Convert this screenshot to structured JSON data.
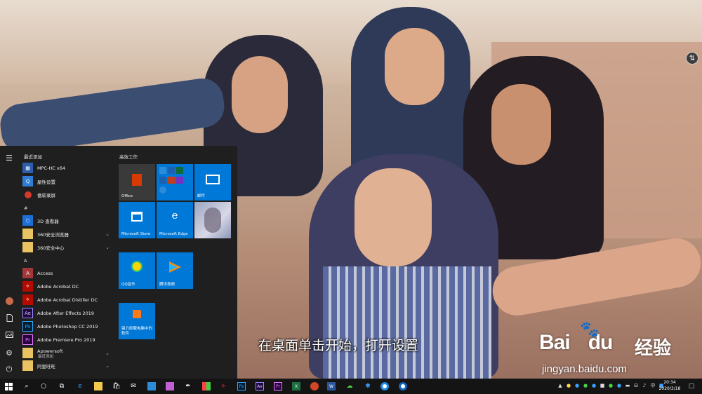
{
  "start_menu": {
    "recent_header": "最近添加",
    "tiles_header": "高效工作",
    "recent_apps": [
      {
        "label": "MPC-HC x64",
        "icon": "mpc-hc-icon",
        "color": "#2b5fae"
      },
      {
        "label": "屋性设置",
        "icon": "settings-tool-icon",
        "color": "#2f7dd6"
      },
      {
        "label": "傲软录屏",
        "icon": "screen-recorder-icon",
        "color": "#d33a2c"
      }
    ],
    "section_hash": "#",
    "hash_apps": [
      {
        "label": "3D 查看器",
        "icon": "3d-viewer-icon",
        "color": "#1d6fd8"
      },
      {
        "label": "360安全浏览器",
        "icon": "folder-icon",
        "color": "#e9c261"
      },
      {
        "label": "360安全中心",
        "icon": "folder-icon",
        "color": "#e9c261"
      }
    ],
    "section_a": "A",
    "a_apps": [
      {
        "label": "Access",
        "icon": "access-icon",
        "color": "#a4373a"
      },
      {
        "label": "Adobe Acrobat DC",
        "icon": "acrobat-icon",
        "color": "#b30b00"
      },
      {
        "label": "Adobe Acrobat Distiller DC",
        "icon": "acrobat-distiller-icon",
        "color": "#b30b00"
      },
      {
        "label": "Adobe After Effects 2019",
        "icon": "after-effects-icon",
        "color": "#1f0740"
      },
      {
        "label": "Adobe Photoshop CC 2019",
        "icon": "photoshop-icon",
        "color": "#001d34"
      },
      {
        "label": "Adobe Premiere Pro 2019",
        "icon": "premiere-icon",
        "color": "#2a003f"
      },
      {
        "label": "Apowersoft",
        "icon": "folder-icon",
        "color": "#e9c261"
      },
      {
        "label": "阿里旺旺",
        "icon": "folder-icon",
        "color": "#e9c261"
      }
    ],
    "apowersoft_sub": "最近添加",
    "ae_abbr": "Ae",
    "ps_abbr": "Ps",
    "pr_abbr": "Pr",
    "tiles": {
      "office": "Office",
      "mail": "邮件",
      "store": "Microsoft Store",
      "edge": "Microsoft Edge",
      "qq_music": "QQ音乐",
      "tencent_video": "腾讯视频",
      "uninstaller": "强力卸载电脑中的软件"
    },
    "accent_color": "#0078d7"
  },
  "caption": "在桌面单击开始，打开设置",
  "watermark": {
    "brand": "Bai",
    "brand2": "du",
    "cn": "经验",
    "url": "jingyan.baidu.com"
  },
  "taskbar": {
    "time": "20:34",
    "date": "2020/3/18",
    "pinned": [
      {
        "name": "edge-icon"
      },
      {
        "name": "file-explorer-icon"
      },
      {
        "name": "store-icon"
      },
      {
        "name": "mail-icon"
      },
      {
        "name": "photos-icon"
      },
      {
        "name": "pen-app-icon"
      },
      {
        "name": "color-app-icon"
      },
      {
        "name": "acrobat-icon"
      },
      {
        "name": "photoshop-icon"
      },
      {
        "name": "after-effects-icon"
      },
      {
        "name": "premiere-icon"
      },
      {
        "name": "excel-icon"
      },
      {
        "name": "powerpoint-icon"
      },
      {
        "name": "word-icon"
      },
      {
        "name": "wechat-icon"
      },
      {
        "name": "bluetooth-app-icon"
      },
      {
        "name": "browser-icon"
      },
      {
        "name": "browser2-icon"
      }
    ],
    "ps_abbr": "Ps",
    "ae_abbr": "Ae",
    "pr_abbr": "Pr",
    "x_abbr": "X",
    "w_abbr": "W"
  }
}
